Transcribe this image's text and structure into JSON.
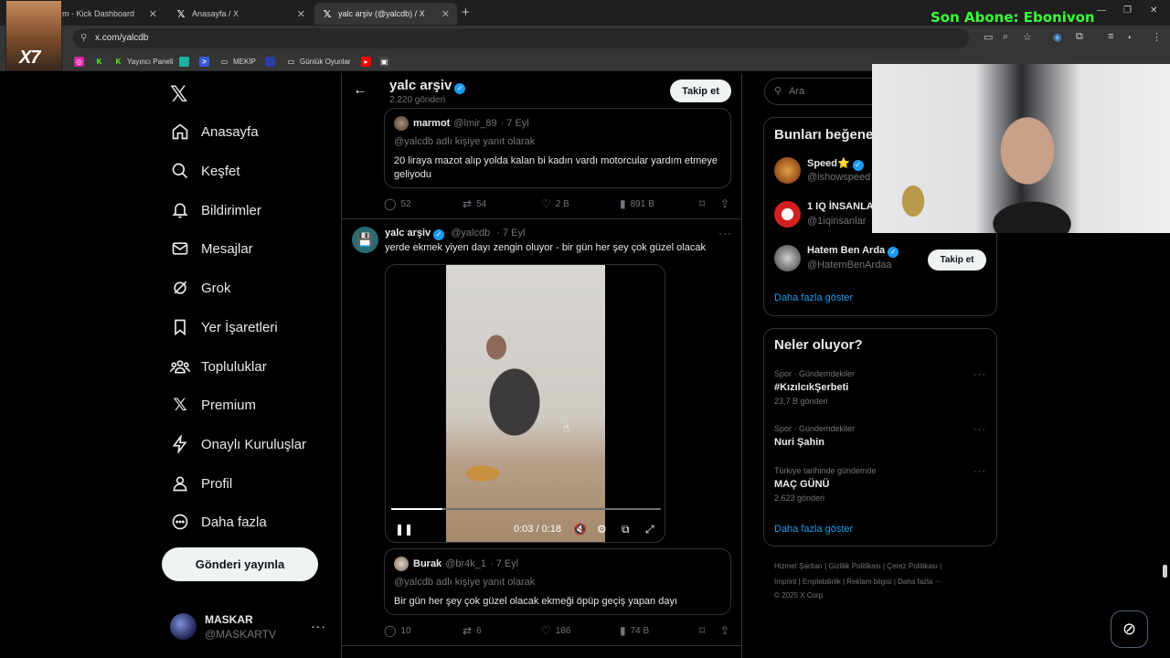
{
  "browser": {
    "tabs": [
      {
        "label": "m - Kick Dashboard",
        "icon": "kick-icon"
      },
      {
        "label": "Anasayfa / X",
        "icon": "x-icon"
      },
      {
        "label": "yalc arşiv (@yalcdb) / X",
        "icon": "x-icon"
      }
    ],
    "url": "x.com/yalcdb",
    "bookmarks": [
      {
        "label": "",
        "icon": "x-icon",
        "color": "#000000"
      },
      {
        "label": "",
        "icon": "instagram-icon",
        "color": "#d6249f"
      },
      {
        "label": "",
        "icon": "kick-icon",
        "color": "#53fc18"
      },
      {
        "label": "Yayıncı Paneli",
        "icon": "kick-icon",
        "color": "#53fc18"
      },
      {
        "label": "",
        "icon": "bookmark-icon",
        "color": "#1bb3a0"
      },
      {
        "label": "",
        "icon": "play-icon",
        "color": "#3b5bdb"
      },
      {
        "label": "MEKİP",
        "icon": "folder-icon",
        "color": "#6b6b6b"
      },
      {
        "label": "",
        "icon": "bookmark-icon",
        "color": "#2b3da8"
      },
      {
        "label": "Günlük Oyunlar",
        "icon": "folder-icon",
        "color": "#6b6b6b"
      },
      {
        "label": "",
        "icon": "youtube-icon",
        "color": "#ff0000"
      },
      {
        "label": "",
        "icon": "image-icon",
        "color": "#444444"
      }
    ]
  },
  "overlay": {
    "text": "Son Abone: Ebonivon",
    "color": "#39ff3a",
    "stream_badge": "X7"
  },
  "nav": {
    "items": [
      {
        "label": "Anasayfa",
        "icon": "home-icon"
      },
      {
        "label": "Keşfet",
        "icon": "search-icon"
      },
      {
        "label": "Bildirimler",
        "icon": "bell-icon"
      },
      {
        "label": "Mesajlar",
        "icon": "mail-icon"
      },
      {
        "label": "Grok",
        "icon": "grok-icon"
      },
      {
        "label": "Yer İşaretleri",
        "icon": "bookmark-icon"
      },
      {
        "label": "Topluluklar",
        "icon": "communities-icon"
      },
      {
        "label": "Premium",
        "icon": "x-icon"
      },
      {
        "label": "Onaylı Kuruluşlar",
        "icon": "lightning-icon"
      },
      {
        "label": "Profil",
        "icon": "person-icon"
      },
      {
        "label": "Daha fazla",
        "icon": "more-circle-icon"
      }
    ],
    "post_button": "Gönderi yayınla",
    "account": {
      "name": "MASKAR",
      "handle": "@MASKARTV"
    }
  },
  "profile_header": {
    "name": "yalc arşiv",
    "post_count": "2.220 gönderi",
    "follow_label": "Takip et"
  },
  "tweets": [
    {
      "quote": {
        "name": "marmot",
        "handle": "@lmir_89",
        "time": "· 7 Eyl",
        "reply_to": "@yalcdb adlı kişiye yanıt olarak",
        "text": "20 liraya mazot alıp yolda kalan bi kadın vardı motorcular yardım etmeye geliyodu"
      },
      "stats": {
        "replies": "52",
        "reposts": "54",
        "likes": "2 B",
        "views": "891 B"
      }
    },
    {
      "name": "yalc arşiv",
      "handle": "@yalcdb",
      "time": "· 7 Eyl",
      "text": "yerde ekmek yiyen dayı zengin oluyor - bir gün her şey çok güzel olacak",
      "video": {
        "time": "0:03 / 0:18",
        "progress": 0.19
      },
      "quote": {
        "name": "Burak",
        "handle": "@br4k_1",
        "time": "· 7 Eyl",
        "reply_to": "@yalcdb adlı kişiye yanıt olarak",
        "text": "Bir gün her şey çok güzel olacak ekmeği öpüp geçiş yapan dayı"
      },
      "stats": {
        "replies": "10",
        "reposts": "6",
        "likes": "186",
        "views": "74 B"
      }
    }
  ],
  "sidebar": {
    "search_placeholder": "Ara",
    "who_to_follow": {
      "title": "Bunları beğene",
      "people": [
        {
          "name": "Speed⭐",
          "handle": "@ishowspeed"
        },
        {
          "name": "1 IQ İNSANLA",
          "handle": "@1iqinsanlar"
        },
        {
          "name": "Hatem Ben Arda",
          "handle": "@HatemBenArdaa"
        }
      ],
      "follow_label": "Takip et",
      "show_more": "Daha fazla göster"
    },
    "trends": {
      "title": "Neler oluyor?",
      "items": [
        {
          "context": "Spor · Gündemdekiler",
          "topic": "#KızılcıkŞerbeti",
          "count": "23,7 B gönderi"
        },
        {
          "context": "Spor · Gündemdekiler",
          "topic": "Nuri Şahin",
          "count": ""
        },
        {
          "context": "Türkiye tarihinde gündemde",
          "topic": "MAÇ GÜNÜ",
          "count": "2.623 gönderi"
        }
      ],
      "show_more": "Daha fazla göster"
    },
    "footer": {
      "line1": "Hizmet Şartları  |  Gizlilik Politikası  |  Çerez Politikası  |",
      "line2": "Imprint  |  Erişilebilirlik  |  Reklam bilgisi  |  Daha fazla ···",
      "line3": "© 2025 X Corp."
    }
  }
}
